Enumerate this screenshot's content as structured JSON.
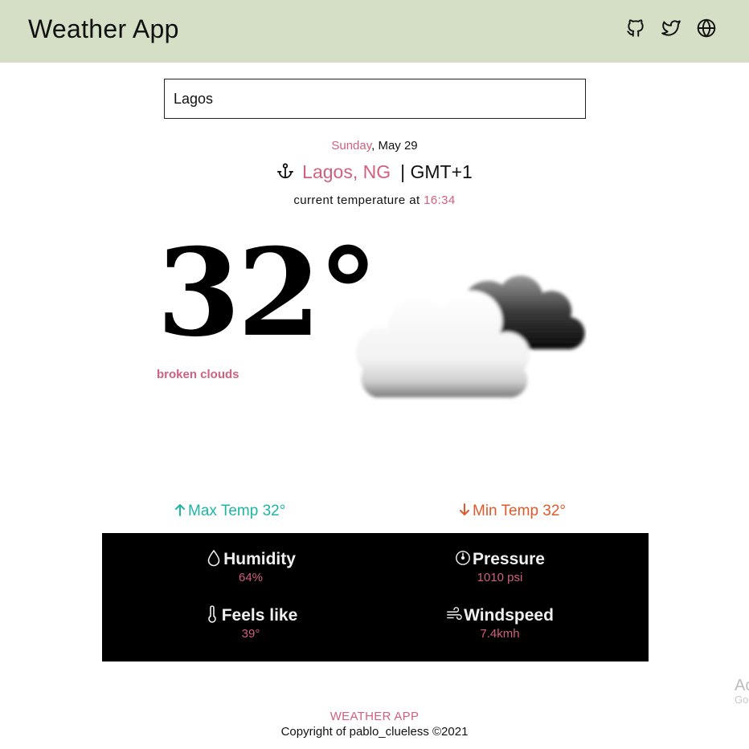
{
  "header": {
    "title": "Weather App",
    "icons": [
      "github-icon",
      "twitter-icon",
      "globe-icon"
    ]
  },
  "search": {
    "value": "Lagos"
  },
  "date": {
    "day": "Sunday",
    "rest": ", May 29"
  },
  "location": {
    "icon": "anchor-icon",
    "city": "Lagos, NG",
    "timezone": "| GMT+1"
  },
  "current": {
    "prefix": "current temperature at ",
    "time": "16:34"
  },
  "weather": {
    "temperature": "32°",
    "description": "broken clouds",
    "icon": "broken-clouds-icon"
  },
  "range": {
    "max_label": "Max Temp 32°",
    "min_label": "Min Temp 32°"
  },
  "details": {
    "humidity": {
      "label": "Humidity",
      "value": "64%",
      "icon": "droplet-icon"
    },
    "pressure": {
      "label": "Pressure",
      "value": "1010 psi",
      "icon": "gauge-icon"
    },
    "feels_like": {
      "label": "Feels like",
      "value": "39°",
      "icon": "thermometer-icon"
    },
    "windspeed": {
      "label": "Windspeed",
      "value": "7.4kmh",
      "icon": "wind-icon"
    }
  },
  "footer": {
    "title": "WEATHER APP",
    "copyright": "Copyright of pablo_clueless ©2021"
  },
  "ad_fragment": {
    "line1": "Ac",
    "line2": "Go"
  },
  "colors": {
    "header_bg": "#d5dfc6",
    "accent_pink": "#d0607e",
    "max_teal": "#1fb5a4",
    "min_orange": "#e0592b",
    "details_bg": "#000000"
  }
}
